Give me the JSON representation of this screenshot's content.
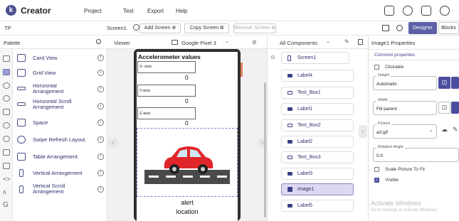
{
  "app": {
    "logo": "k",
    "title": "Creator",
    "menu": [
      "Project",
      "Test",
      "Export",
      "Help"
    ]
  },
  "toolbar": {
    "project": "TP",
    "screen": "Screen1",
    "add": "Add Screen ⊕",
    "copy": "Copy Screen ⧉",
    "remove": "Remove Screen ⊗",
    "designer": "Designer",
    "blocks": "Blocks"
  },
  "palette": {
    "title": "Palette",
    "items": [
      {
        "label": "Card View"
      },
      {
        "label": "Grid View"
      },
      {
        "label": "Horizontal\nArrangement"
      },
      {
        "label": "Horizontal Scroll\nArrangement"
      },
      {
        "label": "Space"
      },
      {
        "label": "Swipe Refresh Layout"
      },
      {
        "label": "Table Arrangement"
      },
      {
        "label": "Vertical Arrangement"
      },
      {
        "label": "Vertical Scroll\nArrangement"
      }
    ]
  },
  "viewer": {
    "title": "Viewer",
    "device": "Google Pixel 3"
  },
  "phone": {
    "heading": "Accelerometer values",
    "x_label": "X- axis:",
    "x_value": "0",
    "y_label": "Y-axis:",
    "y_value": "0",
    "z_label": "Z-axis:",
    "z_value": "0",
    "alert": "alert",
    "location": "location"
  },
  "components": {
    "filter": "All Components",
    "items": [
      "Screen1",
      "Label4",
      "Text_Box1",
      "Label1",
      "Text_Box2",
      "Label2",
      "Text_Box3",
      "Label3",
      "Image1",
      "Label5"
    ]
  },
  "properties": {
    "title": "Image1 Properties",
    "section": "Common properties",
    "clickable": "Clickable",
    "height_label": "Height",
    "height": "Automatic",
    "width_label": "Width",
    "width": "Fill parent",
    "picture_label": "Picture",
    "picture": "a3.gif",
    "rotation_label": "Rotation Angle",
    "rotation": "0.0",
    "scale": "Scale Picture To Fit",
    "visible": "Visible"
  },
  "watermark": {
    "line1": "Activate Windows",
    "line2": "Go to Settings to activate Windows."
  }
}
